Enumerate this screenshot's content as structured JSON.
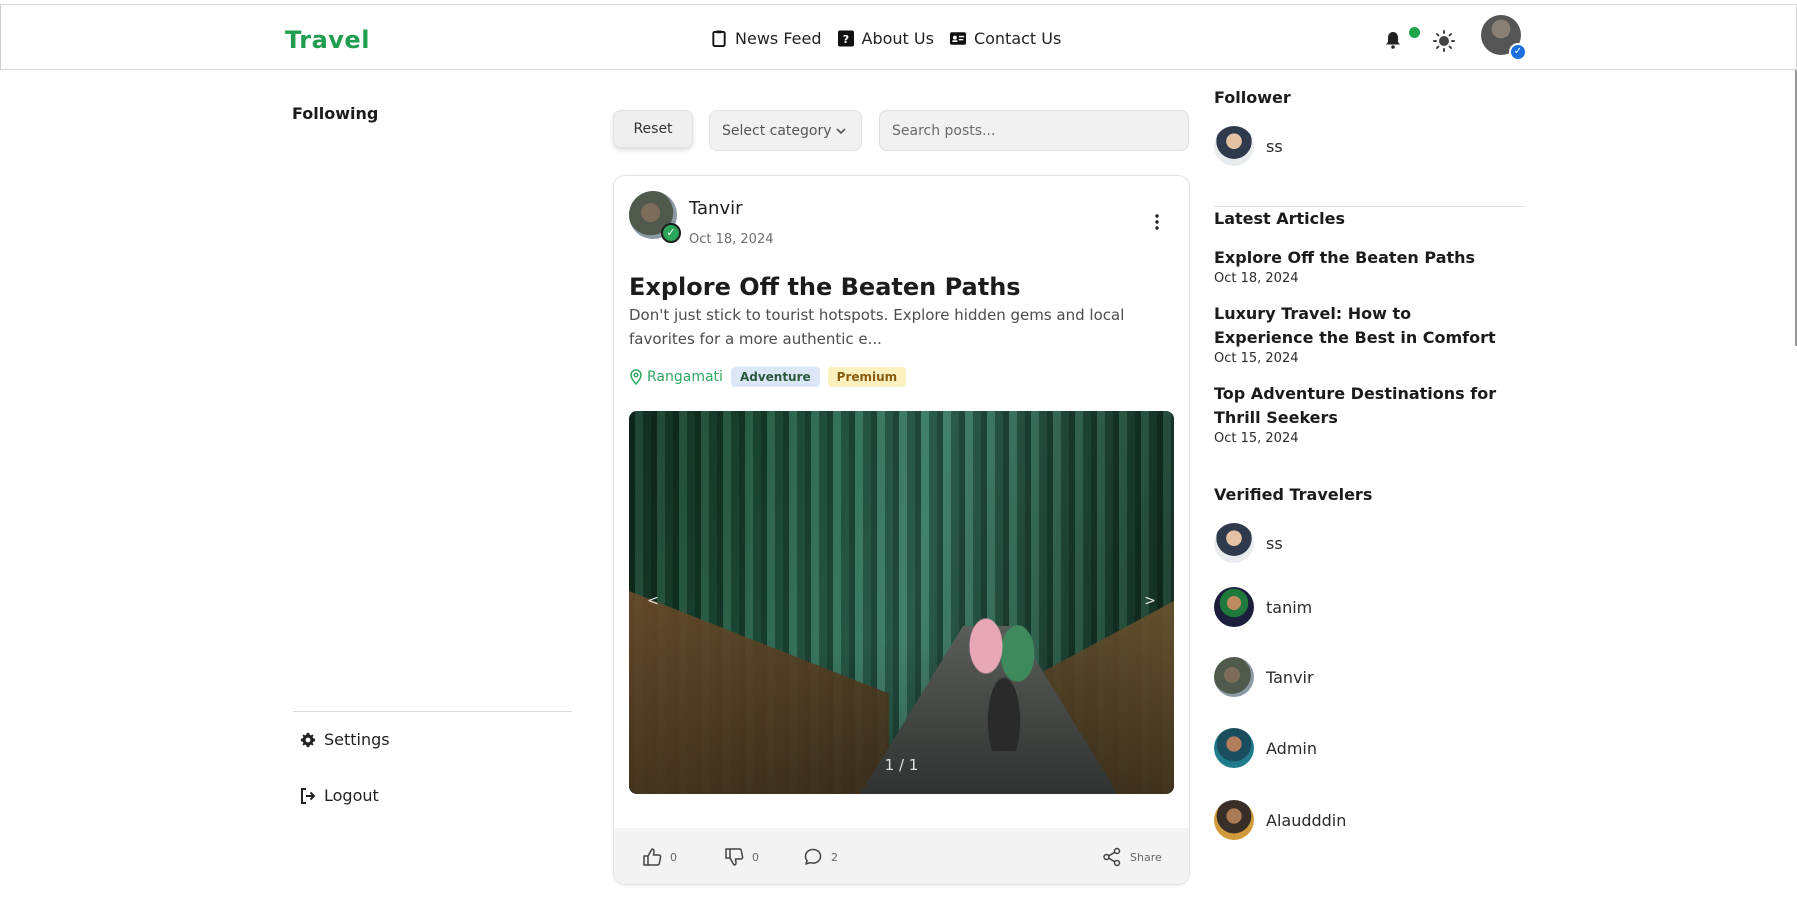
{
  "header": {
    "brand": "Travel",
    "nav": [
      {
        "label": "News Feed",
        "icon": "clipboard-icon"
      },
      {
        "label": "About Us",
        "icon": "question-icon"
      },
      {
        "label": "Contact Us",
        "icon": "contact-card-icon"
      }
    ],
    "colors": {
      "brand": "#1f9e4f",
      "notification_dot": "#1ea34a",
      "verified": "#1b6fe0"
    }
  },
  "left_sidebar": {
    "title": "Following",
    "links": [
      {
        "label": "Settings",
        "icon": "gear-icon"
      },
      {
        "label": "Logout",
        "icon": "logout-icon"
      }
    ]
  },
  "filters": {
    "reset_label": "Reset",
    "category_value": "Select category",
    "search_placeholder": "Search posts..."
  },
  "post": {
    "author": "Tanvir",
    "date": "Oct 18, 2024",
    "title": "Explore Off the Beaten Paths",
    "excerpt": "Don't just stick to tourist hotspots. Explore hidden gems and local favorites for a more authentic e...",
    "location": "Rangamati",
    "tags": [
      "Adventure",
      "Premium"
    ],
    "carousel": {
      "prev": "<",
      "next": ">",
      "counter": "1 / 1"
    },
    "actions": {
      "upvotes": "0",
      "downvotes": "0",
      "comments": "2",
      "share_label": "Share"
    }
  },
  "right_sidebar": {
    "follower_title": "Follower",
    "followers": [
      {
        "name": "ss"
      }
    ],
    "articles_title": "Latest Articles",
    "articles": [
      {
        "title": "Explore Off the Beaten Paths",
        "date": "Oct 18, 2024"
      },
      {
        "title": "Luxury Travel: How to Experience the Best in Comfort",
        "date": "Oct 15, 2024"
      },
      {
        "title": "Top Adventure Destinations for Thrill Seekers",
        "date": "Oct 15, 2024"
      }
    ],
    "verified_title": "Verified Travelers",
    "verified": [
      {
        "name": "ss"
      },
      {
        "name": "tanim"
      },
      {
        "name": "Tanvir"
      },
      {
        "name": "Admin"
      },
      {
        "name": "Alaudddin"
      }
    ]
  }
}
